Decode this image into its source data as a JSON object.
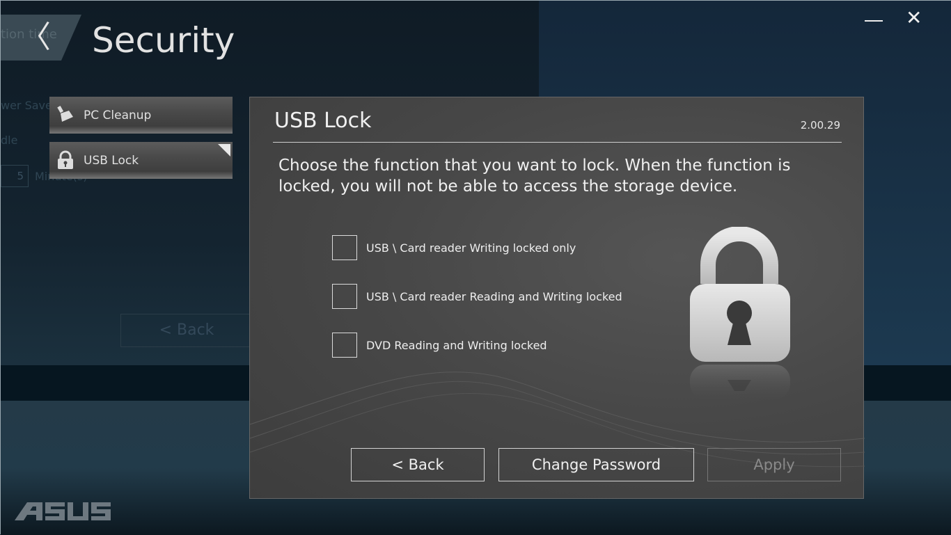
{
  "window": {
    "minimize_icon": "minimize-icon",
    "close_icon": "close-icon"
  },
  "header": {
    "title": "Security",
    "back_ghost_text": "tion time"
  },
  "background": {
    "power_saver": "wer Saver",
    "idle": "dle",
    "minutes_value": "5",
    "minutes_unit": "Minute(s)",
    "back_label": "< Back"
  },
  "sidebar": {
    "items": [
      {
        "label": "PC Cleanup",
        "icon": "broom-icon",
        "selected": false
      },
      {
        "label": "USB Lock",
        "icon": "lock-icon",
        "selected": true
      }
    ]
  },
  "panel": {
    "title": "USB Lock",
    "version": "2.00.29",
    "description": "Choose the function that you want to lock. When the function is locked, you will not be able to access the storage device.",
    "options": [
      {
        "label": "USB \\ Card reader Writing locked only",
        "checked": false
      },
      {
        "label": "USB \\ Card reader Reading and Writing locked",
        "checked": false
      },
      {
        "label": "DVD Reading and Writing locked",
        "checked": false
      }
    ],
    "buttons": {
      "back": "< Back",
      "change_password": "Change Password",
      "apply": "Apply"
    }
  },
  "logo": {
    "text": "ASUS"
  }
}
